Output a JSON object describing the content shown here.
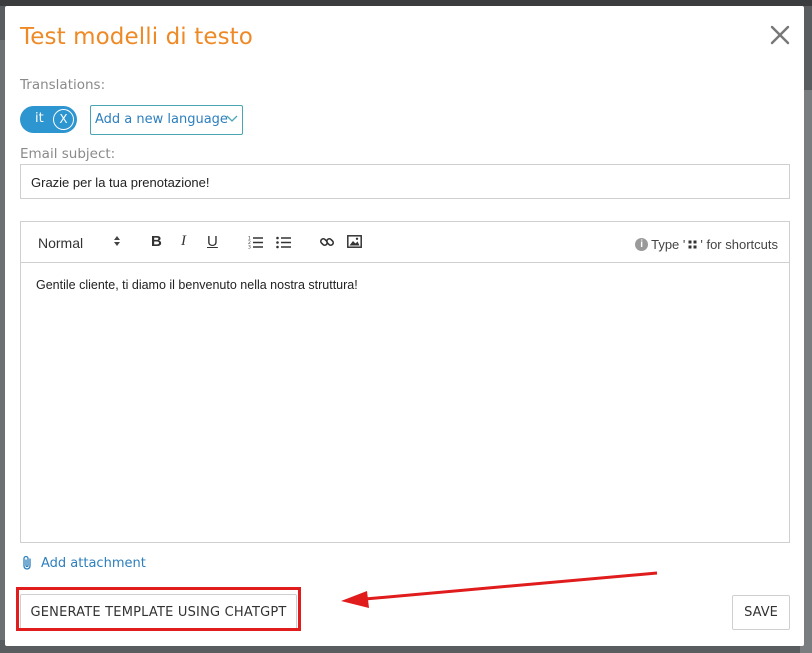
{
  "modal": {
    "title": "Test modelli di testo"
  },
  "translations": {
    "label": "Translations:",
    "current_language": "it",
    "remove_symbol": "X",
    "add_language": "Add a new language"
  },
  "subject": {
    "label": "Email subject:",
    "value": "Grazie per la tua prenotazione!"
  },
  "editor": {
    "format_select": "Normal",
    "bold_label": "B",
    "italic_label": "I",
    "underline_label": "U",
    "hint_prefix": "Type '",
    "hint_suffix": "' for shortcuts",
    "body": "Gentile cliente, ti diamo il benvenuto nella nostra struttura!"
  },
  "attachment": {
    "label": "Add attachment"
  },
  "actions": {
    "generate": "GENERATE TEMPLATE USING CHATGPT",
    "save": "SAVE"
  },
  "colors": {
    "title": "#ee8a26",
    "accent_blue": "#2d95cf",
    "link_blue": "#2d7fbd",
    "annotation_red": "#e01c1c"
  }
}
